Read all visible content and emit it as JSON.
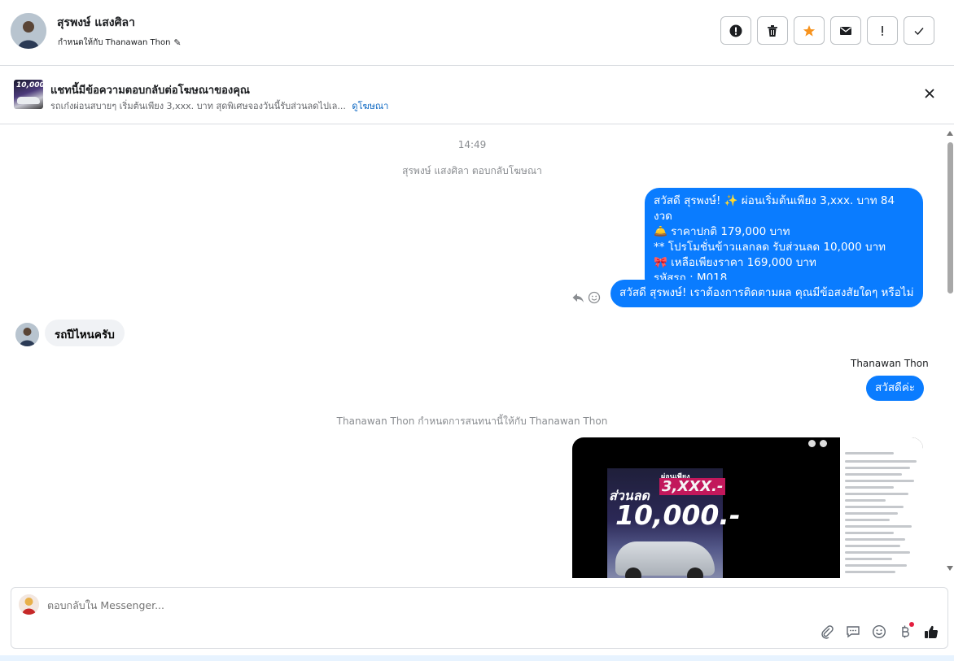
{
  "header": {
    "contact_name": "สุรพงษ์ แสงศิลา",
    "assigned_text": "กำหนดให้กับ Thanawan Thon",
    "actions": [
      {
        "icon": "alert-circle-icon",
        "label": "spam"
      },
      {
        "icon": "trash-icon",
        "label": "delete"
      },
      {
        "icon": "star-icon",
        "label": "star"
      },
      {
        "icon": "mail-icon",
        "label": "mark-unread"
      },
      {
        "icon": "exclamation-icon",
        "label": "follow-up"
      },
      {
        "icon": "check-icon",
        "label": "done"
      }
    ]
  },
  "ad_banner": {
    "thumb_text": "10,000",
    "title": "แชทนี้มีข้อความตอบกลับต่อโฆษณาของคุณ",
    "subtitle": "รถเก๋งผ่อนสบายๆ เริ่มต้นเพียง 3,xxx. บาท สุดพิเศษจองวันนี้รับส่วนลดไปเล...",
    "link": "ดูโฆษณา"
  },
  "chat": {
    "time": "14:49",
    "ad_reply_note": "สุรพงษ์ แสงศิลา ตอบกลับโฆษณา",
    "outgoing_1_lines": [
      "สวัสดี สุรพงษ์! ✨  ผ่อนเริ่มต้นเพียง 3,xxx. บาท 84 งวด",
      "🛎️ ราคาปกติ 179,000 บาท",
      "** โปรโมชั่นข้าวแลกลด รับส่วนลด 10,000 บาท",
      "🎀  เหลือเพียงราคา 169,000 บาท",
      " รหัสรถ : M018"
    ],
    "outgoing_2": "สวัสดี สุรพงษ์! เราต้องการติดตามผล คุณมีข้อสงสัยใดๆ หรือไม่",
    "incoming_1": "รถปีไหนครับ",
    "sender_label": "Thanawan Thon",
    "outgoing_3": "สวัสดีค่ะ",
    "assignment_note": "Thanawan Thon กำหนดการสนทนานี้ให้กับ Thanawan Thon",
    "media_poster": {
      "line1": "ผ่อนเพียง",
      "line2": "3,XXX.-",
      "line3": "ส่วนลด",
      "line4": "10,000.-"
    }
  },
  "composer": {
    "placeholder": "ตอบกลับใน Messenger...",
    "tools": [
      "paperclip-icon",
      "chat-bubble-icon",
      "emoji-icon",
      "baht-icon",
      "thumbs-up-icon"
    ]
  }
}
